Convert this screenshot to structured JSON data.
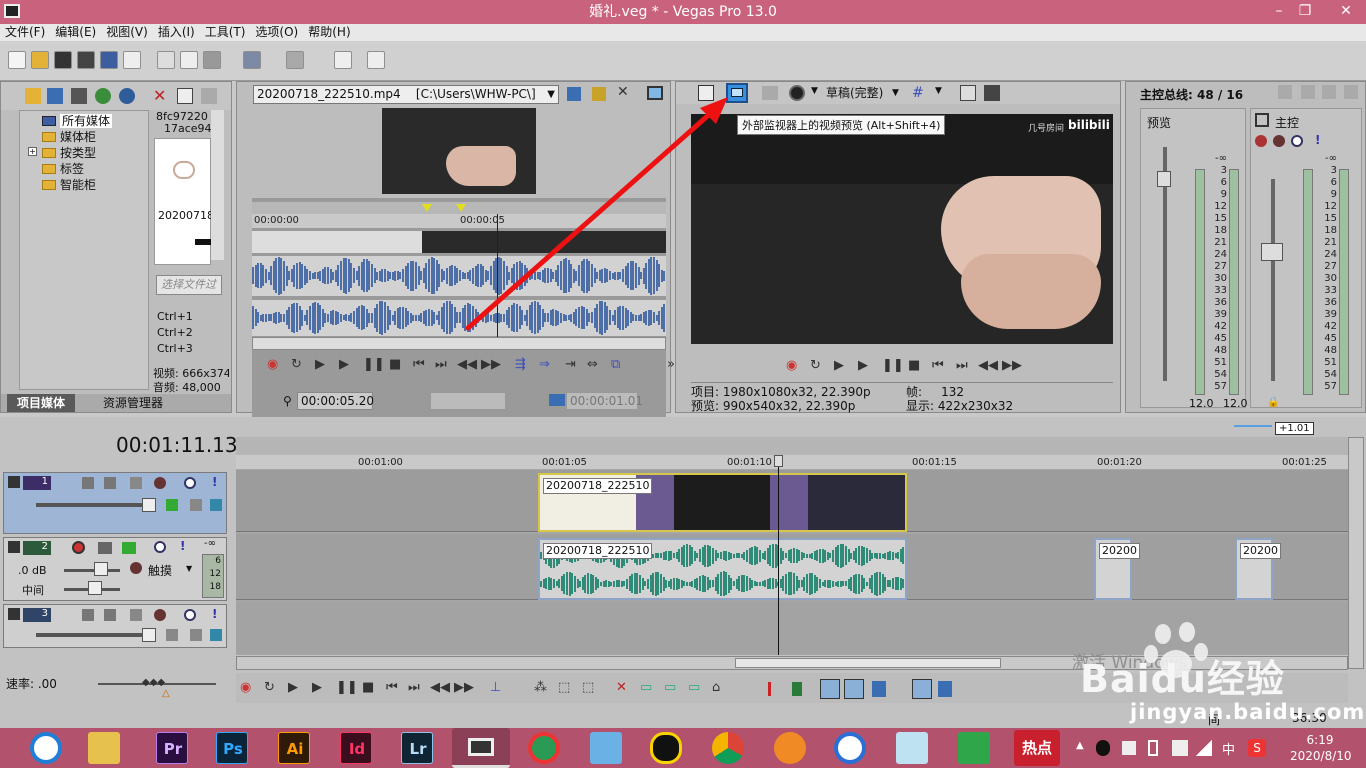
{
  "window": {
    "title": "婚礼.veg * - Vegas Pro 13.0",
    "min": "–",
    "max": "❐",
    "close": "✕"
  },
  "menu": [
    "文件(F)",
    "编辑(E)",
    "视图(V)",
    "插入(I)",
    "工具(T)",
    "选项(O)",
    "帮助(H)"
  ],
  "media": {
    "tree": [
      "所有媒体",
      "媒体柜",
      "按类型",
      "标签",
      "智能柜"
    ],
    "thumb_id1": "8fc97220",
    "thumb_id2": "17ace94",
    "thumb_caption": "20200718",
    "search_placeholder": "选择文件过",
    "shortcuts": [
      "Ctrl+1",
      "Ctrl+2",
      "Ctrl+3"
    ],
    "video_info": "视频: 666x374",
    "audio_info": "音频: 48,000",
    "tabs": [
      "项目媒体",
      "资源管理器"
    ]
  },
  "trimmer": {
    "file": "20200718_222510.mp4",
    "path": "[C:\\Users\\WHW-PC\\]",
    "time_start": "00:00:00",
    "time_mark": "00:00:05",
    "position": "00:00:05.20",
    "length": "00:00:01.01"
  },
  "preview": {
    "mode": "草稿(完整)",
    "tooltip": "外部监视器上的视频预览 (Alt+Shift+4)",
    "watermark": "几号房间",
    "project_label": "项目:",
    "project_value": "1980x1080x32, 22.390p",
    "preview_label": "预览:",
    "preview_value": "990x540x32, 22.390p",
    "frame_label": "帧:",
    "frame_value": "132",
    "display_label": "显示:",
    "display_value": "422x230x32"
  },
  "mixer": {
    "title": "主控总线: 48 / 16",
    "preview_label": "预览",
    "master_label": "主控",
    "scale": [
      "-∞",
      "3",
      "6",
      "9",
      "12",
      "15",
      "18",
      "21",
      "24",
      "27",
      "30",
      "33",
      "36",
      "39",
      "42",
      "45",
      "48",
      "51",
      "54",
      "57"
    ],
    "level_left": "12.0",
    "level_right": "12.0"
  },
  "timeline": {
    "timecode": "00:01:11.13",
    "rate_badge": "+1.01",
    "ruler": [
      "00:01:00",
      "00:01:05",
      "00:01:10",
      "00:01:15",
      "00:01:20",
      "00:01:25"
    ],
    "tracks": [
      {
        "num": "1"
      },
      {
        "num": "2",
        "vol": ".0 dB",
        "pan": "中间",
        "mode": "触摸",
        "meter": [
          "-∞",
          "6",
          "12",
          "18"
        ]
      },
      {
        "num": "3"
      }
    ],
    "clip_label": "20200718_222510",
    "clip_label_short": "20200",
    "rate_label": "速率: .00"
  },
  "status": {
    "time": "36:30",
    "rec_prefix": "间"
  },
  "watermark": {
    "brand": "Baidu经验",
    "url": "jingyan.baidu.com",
    "activate": "激活 Windows"
  },
  "taskbar": {
    "apps": [
      "Pr",
      "Ps",
      "Ai",
      "Id",
      "Lr"
    ],
    "hot": "热点",
    "clock_time": "6:19",
    "clock_date": "2020/8/10",
    "ime": "中"
  },
  "colors": {
    "title": "#c9637d",
    "taskbar": "#b3526d",
    "audio_wave": "#4e6ea8",
    "timeline_wave": "#2f8a78",
    "clip_border": "#d6c64a"
  }
}
